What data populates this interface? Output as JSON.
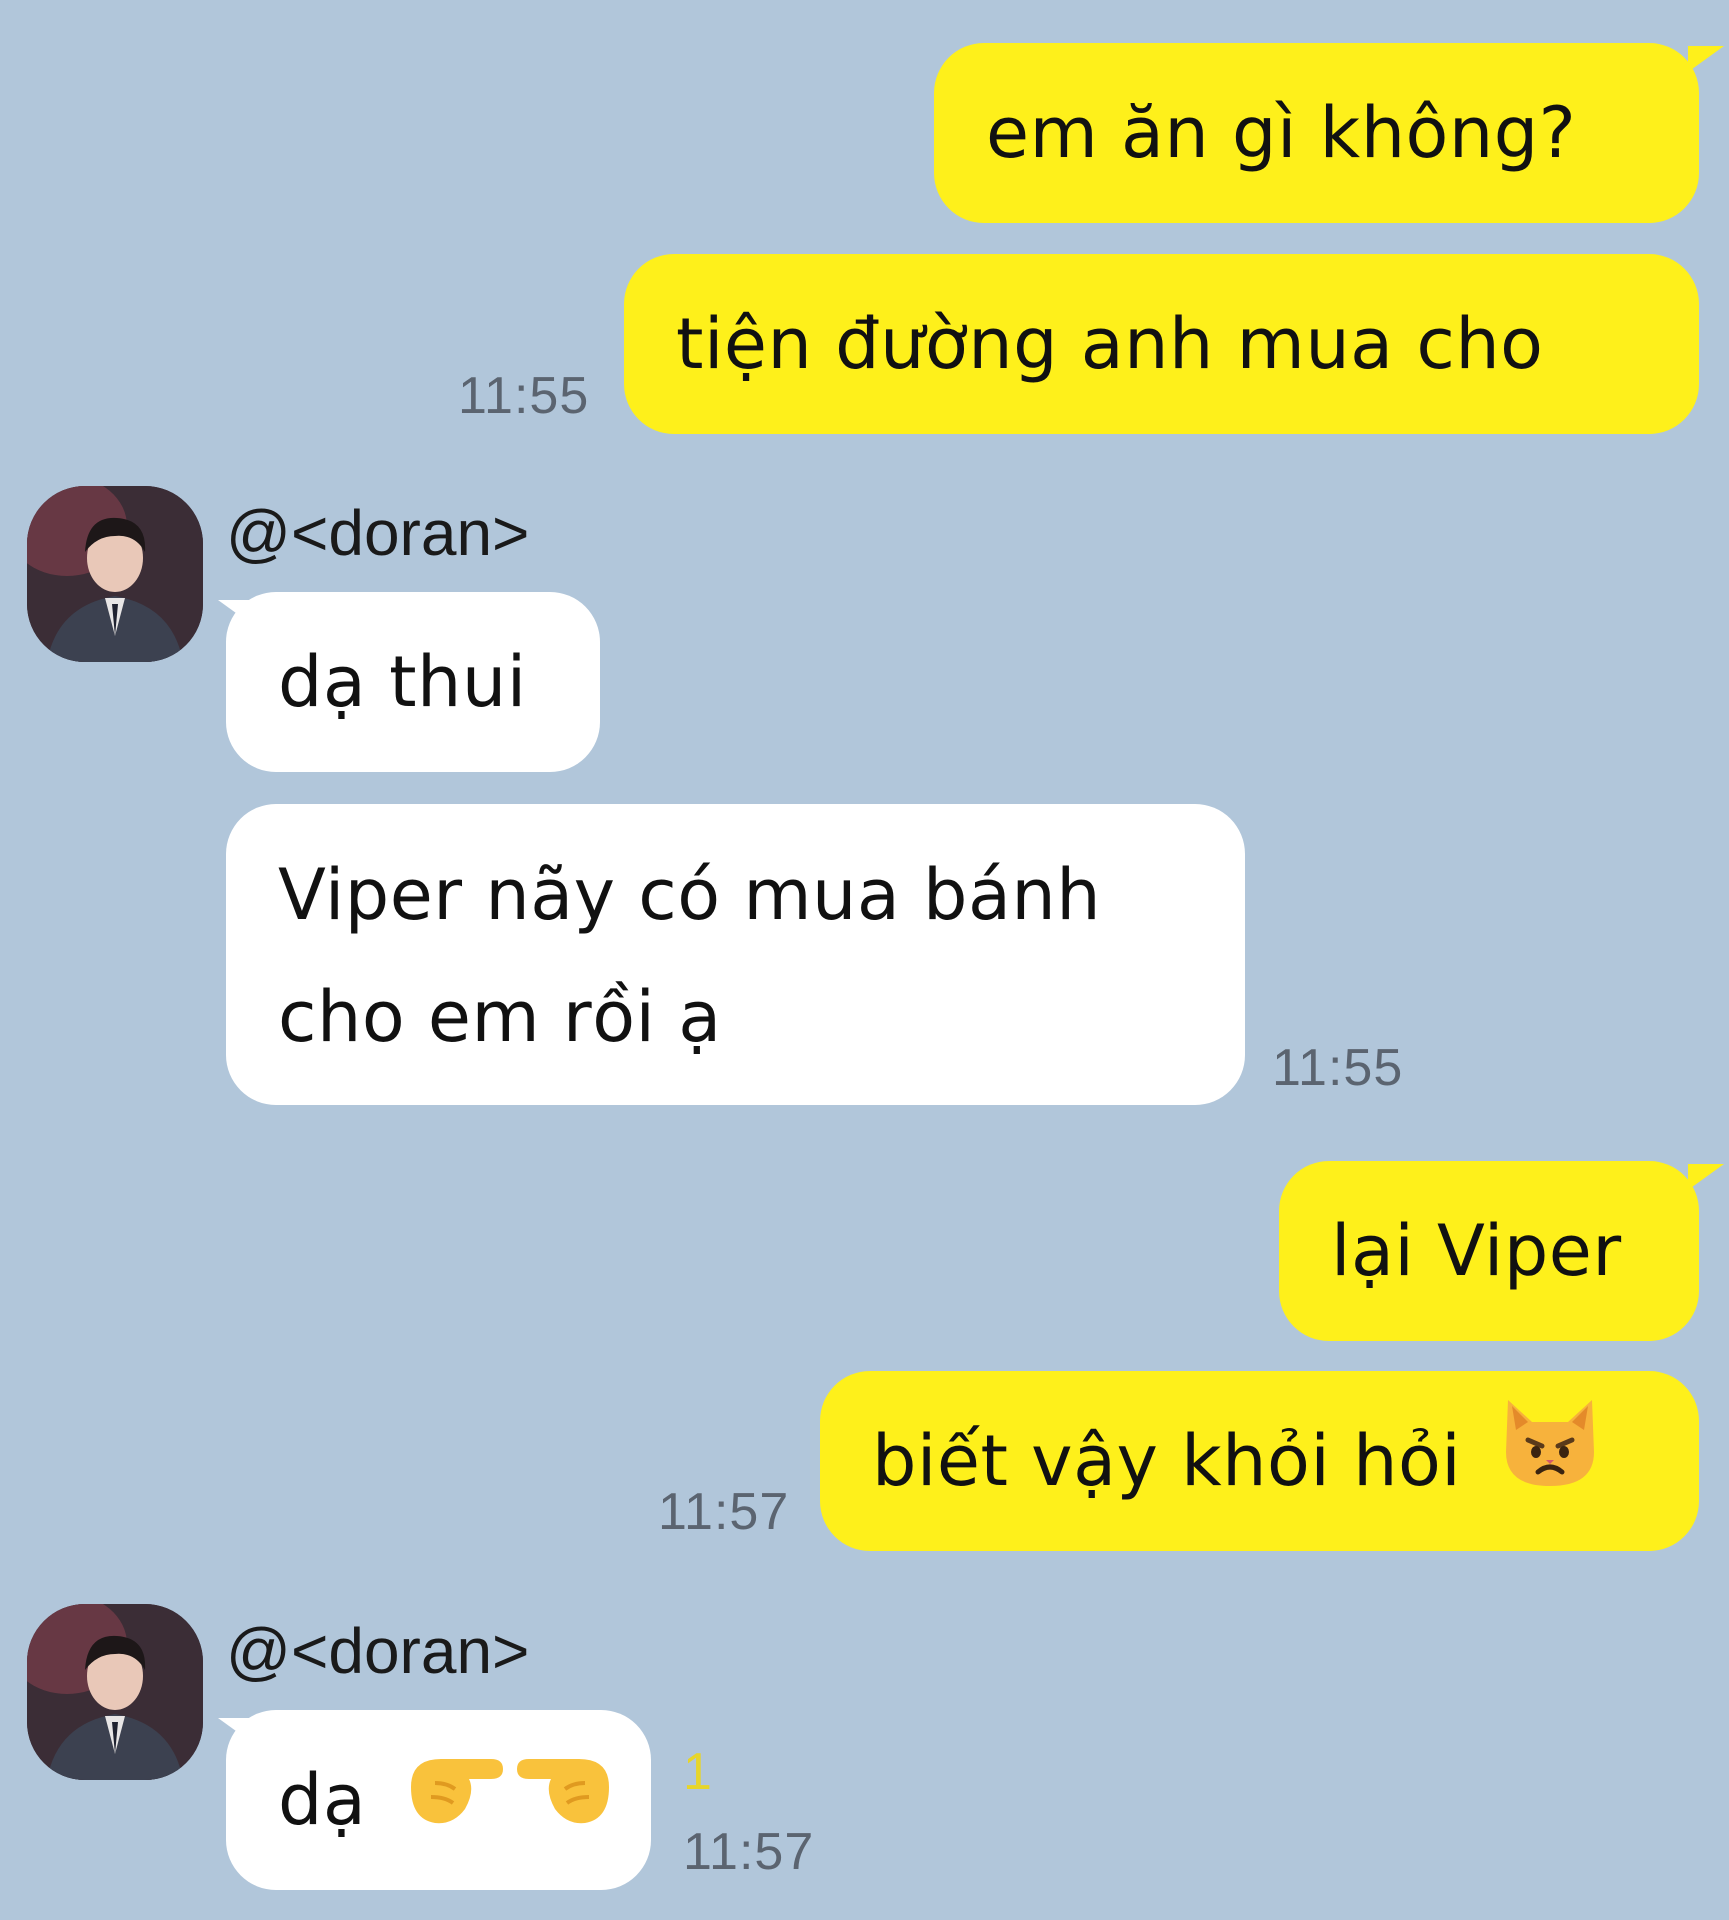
{
  "colors": {
    "background": "#b1c6da",
    "outgoing_bubble": "#fef01b",
    "incoming_bubble": "#ffffff",
    "timestamp": "#5b6470",
    "unread_count": "#e7d52a"
  },
  "messages": [
    {
      "text": "em ăn gì không?"
    },
    {
      "text": "tiện đường anh mua cho",
      "time": "11:55"
    },
    {
      "sender": "@<doran>",
      "avatar": "profile-photo"
    },
    {
      "text": "dạ thui"
    },
    {
      "line1": "Viper nãy có mua bánh",
      "line2": "cho em rồi ạ",
      "time": "11:55"
    },
    {
      "text": "lại Viper"
    },
    {
      "text": "biết vậy khỏi hỏi",
      "emoji": "pouting-cat-icon",
      "time": "11:57"
    },
    {
      "sender": "@<doran>",
      "avatar": "profile-photo"
    },
    {
      "text": "dạ",
      "emoji": "pointing-hands-icon",
      "unread": "1",
      "time": "11:57"
    }
  ]
}
